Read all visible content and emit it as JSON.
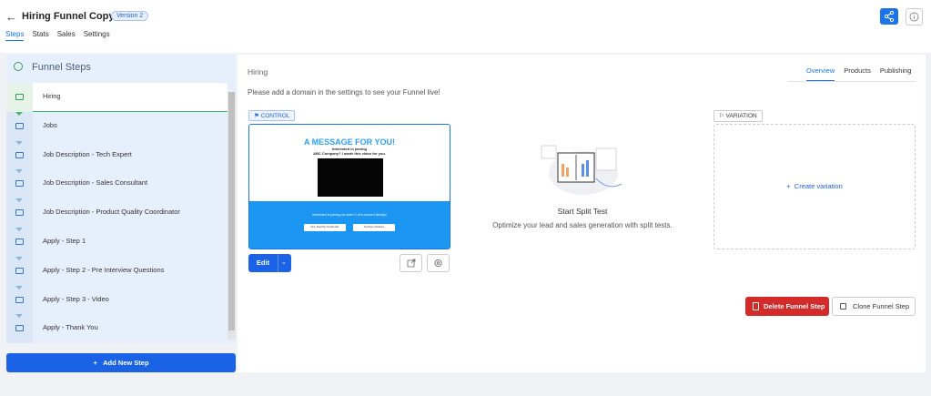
{
  "header": {
    "title": "Hiring Funnel Copy",
    "version": "Version 2",
    "tabs": [
      "Steps",
      "Stats",
      "Sales",
      "Settings"
    ]
  },
  "left": {
    "title": "Funnel Steps",
    "steps": [
      "Hiring",
      "Jobs",
      "Job Description - Tech Expert",
      "Job Description - Sales Consultant",
      "Job Description - Product Quality Coordinator",
      "Apply - Step 1",
      "Apply - Step 2 - Pre Interview Questions",
      "Apply - Step 3 - Video",
      "Apply - Thank You"
    ],
    "add_label": "Add New Step"
  },
  "main": {
    "crumb": "Hiring",
    "tabs": [
      "Overview",
      "Products",
      "Publishing"
    ],
    "notice": "Please add a domain in the settings to see your Funnel live!",
    "control_label": "CONTROL",
    "preview": {
      "headline": "A MESSAGE FOR YOU!",
      "sub1": "Interested in joining",
      "sub2": "ABC Company? I made this video for you.",
      "cta": "Interested in joining our team? Let's connect directly!",
      "btn1": "First, Read Me The Benefits",
      "btn2": "Find Open Positions"
    },
    "edit_label": "Edit",
    "split_title": "Start Split Test",
    "split_desc": "Optimize your lead and sales generation with split tests.",
    "variation_label": "VARIATION",
    "create_variation": "Create variation",
    "delete_label": "Delete Funnel Step",
    "clone_label": "Clone Funnel Step"
  },
  "colors": {
    "primary": "#1a63e6",
    "danger": "#d32a2a",
    "active_green": "#3fb86a"
  }
}
